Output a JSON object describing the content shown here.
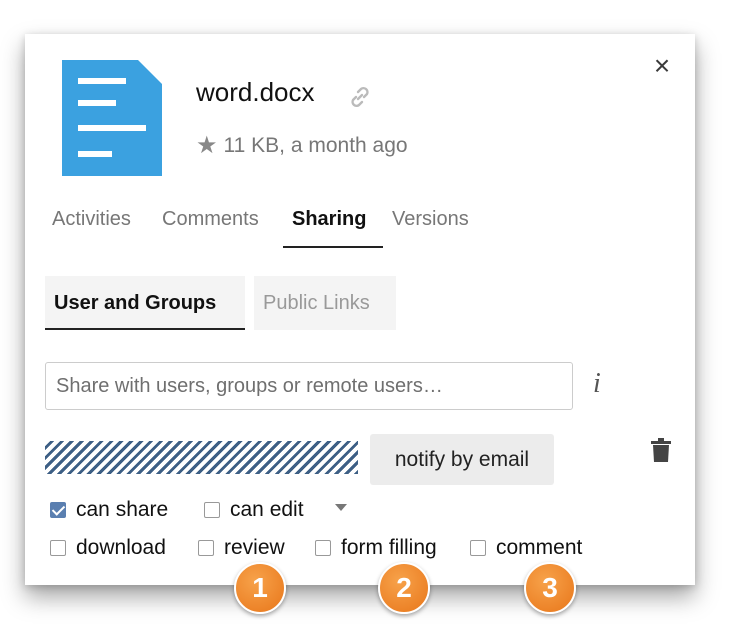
{
  "file": {
    "name": "word.docx",
    "meta": "11 KB, a month ago"
  },
  "tabs": [
    "Activities",
    "Comments",
    "Sharing",
    "Versions"
  ],
  "active_tab": "Sharing",
  "subtabs": [
    "User and Groups",
    "Public Links"
  ],
  "share": {
    "placeholder": "Share with users, groups or remote users…"
  },
  "share_entry": {
    "notify_label": "notify by email"
  },
  "permissions": {
    "can_share": {
      "label": "can share",
      "checked": true
    },
    "can_edit": {
      "label": "can edit",
      "checked": false
    },
    "download": {
      "label": "download",
      "checked": false
    },
    "review": {
      "label": "review",
      "checked": false
    },
    "form_filling": {
      "label": "form filling",
      "checked": false
    },
    "comment": {
      "label": "comment",
      "checked": false
    }
  },
  "badges": [
    "1",
    "2",
    "3"
  ],
  "icons": {
    "close": "close-icon",
    "link": "link-icon",
    "star": "star-icon",
    "info": "info-icon",
    "trash": "trash-icon"
  },
  "colors": {
    "file_icon": "#3ba1e0",
    "badge": "#ef8429",
    "checkbox_checked": "#5a7fb0",
    "hatch": "#3d5f85"
  }
}
